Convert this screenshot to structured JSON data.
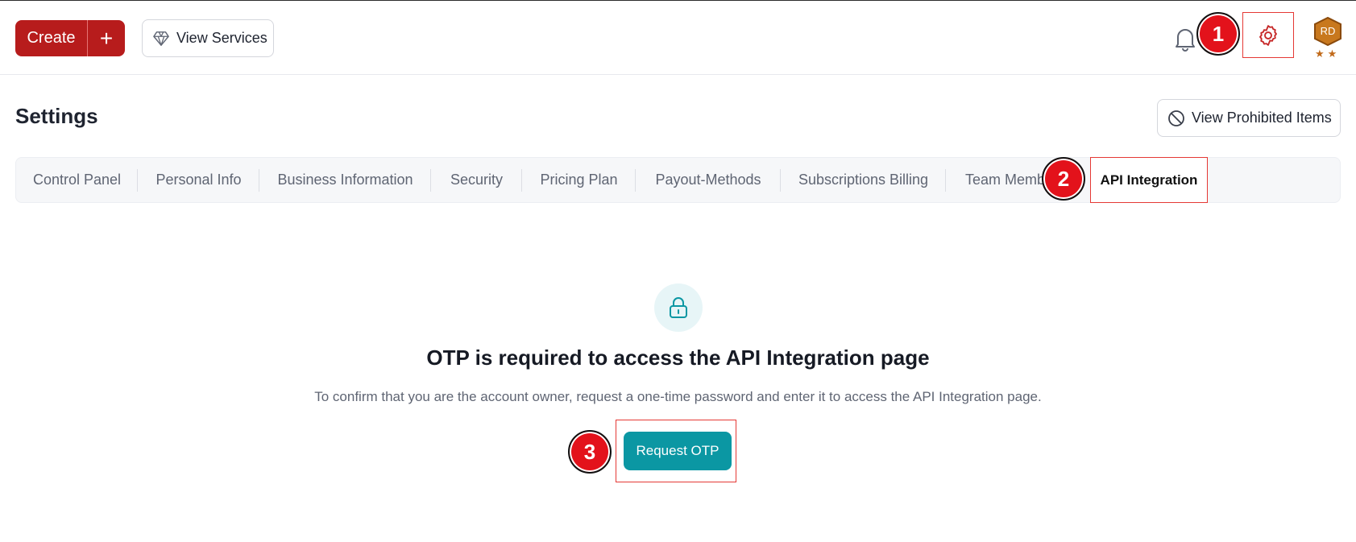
{
  "header": {
    "create_label": "Create",
    "plus_label": "+",
    "view_services_label": "View Services",
    "avatar_initials": "RD",
    "avatar_stars": "★★"
  },
  "page": {
    "title": "Settings",
    "prohibited_label": "View Prohibited Items"
  },
  "tabs": [
    {
      "label": "Control Panel"
    },
    {
      "label": "Personal Info"
    },
    {
      "label": "Business Information"
    },
    {
      "label": "Security"
    },
    {
      "label": "Pricing Plan"
    },
    {
      "label": "Payout-Methods"
    },
    {
      "label": "Subscriptions Billing"
    },
    {
      "label": "Team Memb"
    },
    {
      "label": "API Integration",
      "active": true
    }
  ],
  "otp": {
    "heading": "OTP is required to access the API Integration page",
    "description": "To confirm that you are the account owner, request a one-time password and enter it to access the API Integration page.",
    "button_label": "Request OTP"
  },
  "markers": {
    "m1": "1",
    "m2": "2",
    "m3": "3"
  },
  "colors": {
    "brand_red": "#b71c1c",
    "accent_teal": "#0b97a3",
    "highlight_red": "#e53935",
    "marker_red": "#e3121b"
  },
  "icons": {
    "diamond": "diamond-icon",
    "bell": "bell-icon",
    "gear": "gear-icon",
    "ban": "ban-icon",
    "lock": "lock-icon"
  }
}
